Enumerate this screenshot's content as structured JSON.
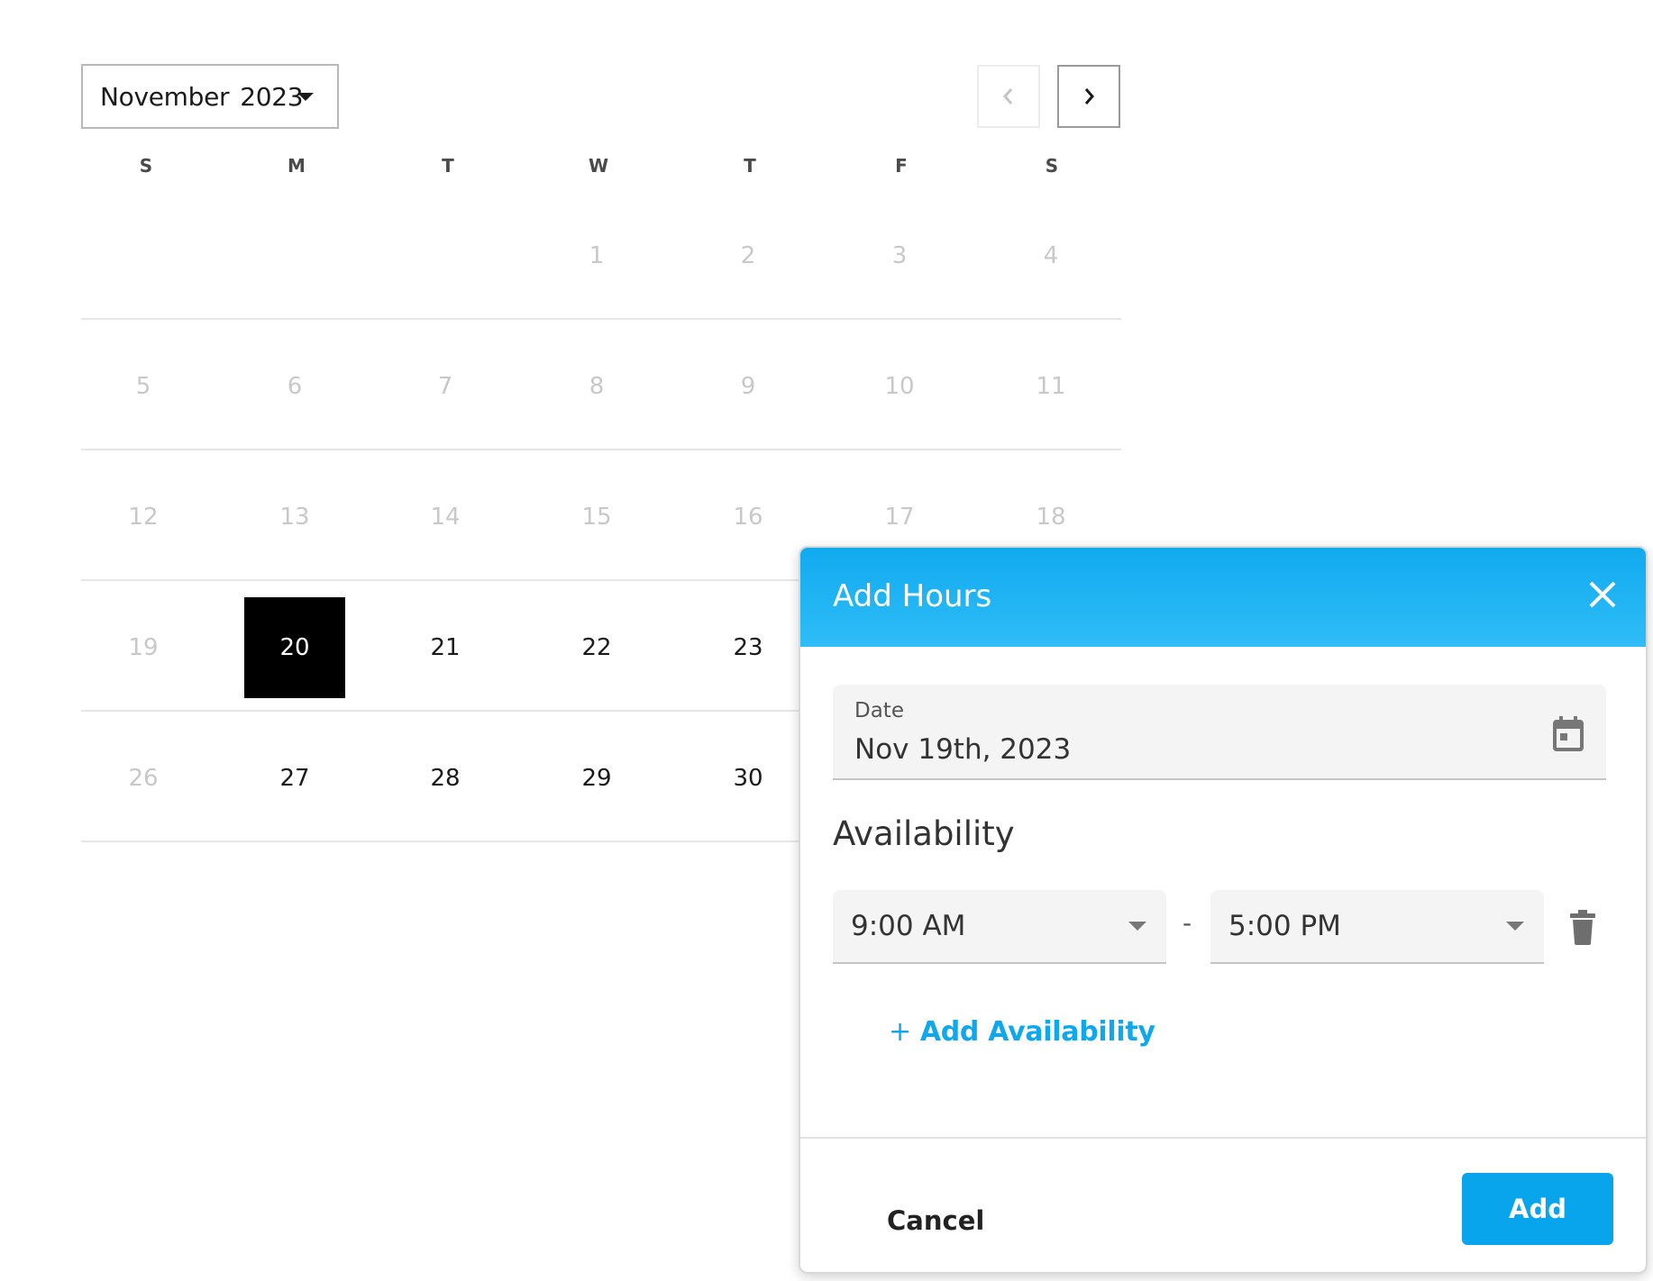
{
  "calendar": {
    "month": "November",
    "year": "2023",
    "weekdays": [
      "S",
      "M",
      "T",
      "W",
      "T",
      "F",
      "S"
    ],
    "days": [
      "1",
      "2",
      "3",
      "4",
      "5",
      "6",
      "7",
      "8",
      "9",
      "10",
      "11",
      "12",
      "13",
      "14",
      "15",
      "16",
      "17",
      "18",
      "19",
      "20",
      "21",
      "22",
      "23",
      "26",
      "27",
      "28",
      "29",
      "30"
    ],
    "selected_day": "20"
  },
  "dialog": {
    "title": "Add Hours",
    "date_label": "Date",
    "date_value": "Nov 19th, 2023",
    "availability_heading": "Availability",
    "start_time": "9:00 AM",
    "separator": "-",
    "end_time": "5:00 PM",
    "add_availability_plus": "+",
    "add_availability_label": "Add Availability",
    "cancel_label": "Cancel",
    "add_label": "Add"
  },
  "colors": {
    "accent": "#08a4ec",
    "header_gradient_top": "#11aaee",
    "selected_day_bg": "#000000"
  },
  "icons": {
    "prev": "chevron-left-icon",
    "next": "chevron-right-icon",
    "close": "close-icon",
    "calendar": "calendar-icon",
    "delete": "trash-icon"
  }
}
